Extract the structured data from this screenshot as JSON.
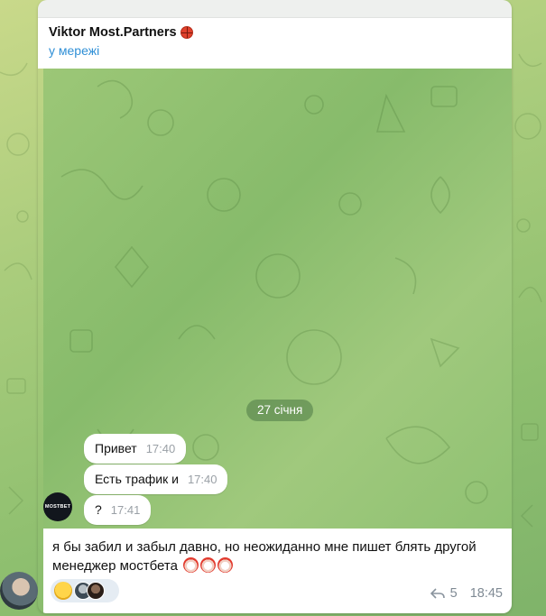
{
  "header": {
    "name": "Viktor Most.Partners",
    "status": "у мережі"
  },
  "chat": {
    "date_separator": "27 січня",
    "messages": [
      {
        "text": "Привет",
        "time": "17:40"
      },
      {
        "text": "Есть трафик и",
        "time": "17:40"
      },
      {
        "text": "?",
        "time": "17:41"
      }
    ],
    "avatar_label": "MOSTBET"
  },
  "message": {
    "text": "я бы забил и забыл давно, но неожиданно мне пишет блять другой менеджер мостбета",
    "emoji_count": 3,
    "reply_count": "5",
    "time": "18:45"
  },
  "colors": {
    "status_blue": "#2f8fd6",
    "bubble_bg": "#ffffff",
    "chat_bg": "#8fc172"
  }
}
